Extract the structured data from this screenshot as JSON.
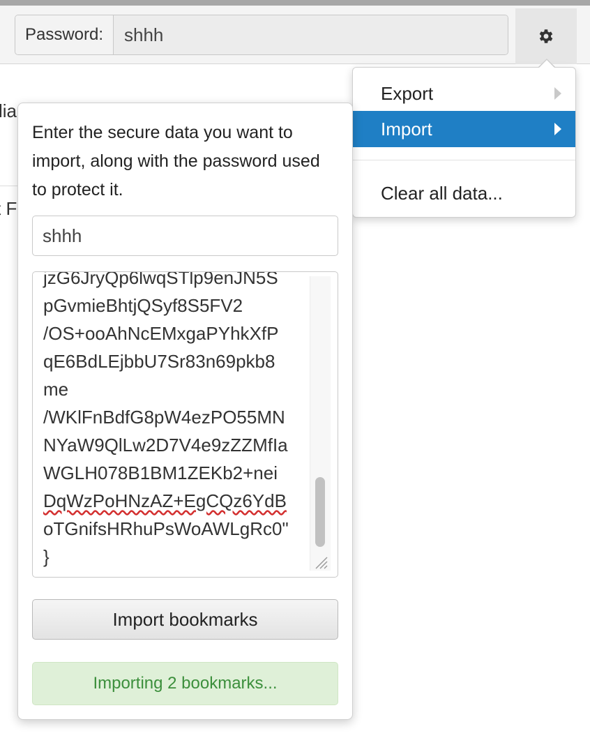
{
  "toolbar": {
    "password_label": "Password:",
    "password_value": "shhh",
    "settings_icon": "gear-icon"
  },
  "background": {
    "text_fragment_1": "lia",
    "text_fragment_2": "t F"
  },
  "menu": {
    "items": [
      {
        "label": "Export",
        "has_submenu": true,
        "active": false
      },
      {
        "label": "Import",
        "has_submenu": true,
        "active": true
      },
      {
        "label": "Clear all data...",
        "has_submenu": false,
        "active": false
      }
    ],
    "active_color": "#1f7fc5"
  },
  "import_panel": {
    "intro": "Enter the secure data you want to import, along with the password used to protect it.",
    "password_value": "shhh",
    "data_lines": [
      "jzG6JryQp6lwqSTlp9enJN5S",
      "pGvmieBhtjQSyf8S5FV2",
      "/OS+ooAhNcEMxgaPYhkXfP",
      "qE6BdLEjbbU7Sr83n69pkb8",
      "me",
      "/WKlFnBdfG8pW4ezPO55MN",
      "NYaW9QlLw2D7V4e9zZZMfIa",
      "WGLH078B1BM1ZEKb2+nei",
      "DqWzPoHNzAZ+EgCQz6YdB",
      "oTGnifsHRhuPsWoAWLgRc0\"",
      "}"
    ],
    "import_button": "Import bookmarks",
    "status": "Importing 2 bookmarks...",
    "status_color": "#dff0d8"
  }
}
